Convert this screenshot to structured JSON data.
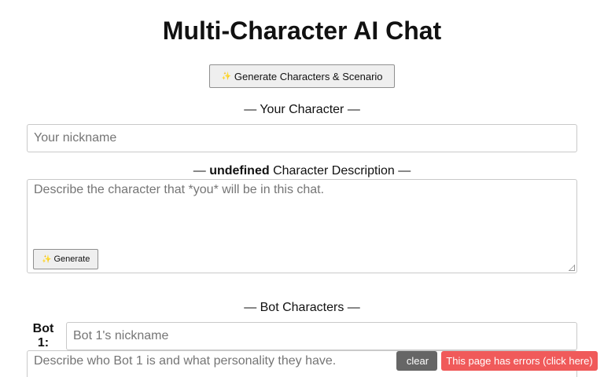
{
  "page": {
    "title": "Multi-Character AI Chat"
  },
  "generate_all": {
    "icon": "sparkles-icon",
    "glyph": "✨",
    "label": "Generate Characters & Scenario"
  },
  "your_character": {
    "heading": "— Your Character —",
    "nickname_placeholder": "Your nickname",
    "description_heading_prefix": "— ",
    "description_heading_name": "undefined",
    "description_heading_suffix": " Character Description —",
    "description_placeholder": "Describe the character that *you* will be in this chat.",
    "generate_label": "Generate",
    "generate_glyph": "✨"
  },
  "bot_characters": {
    "heading": "— Bot Characters —",
    "bots": [
      {
        "label": "Bot 1:",
        "nickname_placeholder": "Bot 1's nickname",
        "description_placeholder": "Describe who Bot 1 is and what personality they have."
      }
    ]
  },
  "overlay": {
    "clear_glyph": "",
    "clear_label": "clear",
    "error_label": "This page has errors (click here)"
  }
}
